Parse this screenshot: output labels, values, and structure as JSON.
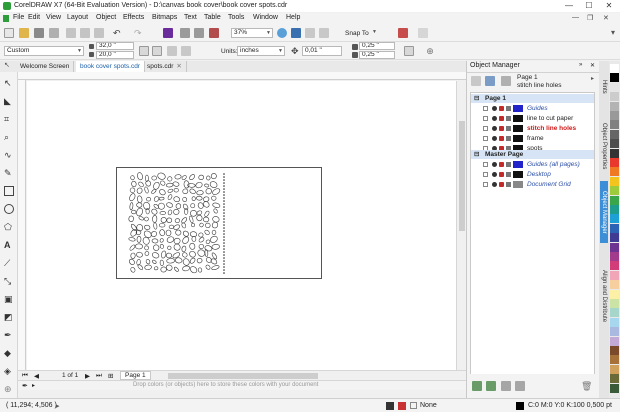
{
  "window": {
    "title": "CorelDRAW X7 (64-Bit Evaluation Version) - D:\\canvas book cover\\book cover spots.cdr"
  },
  "window_controls": {
    "minimize": "—",
    "maximize": "☐",
    "close": "✕"
  },
  "menu": [
    "File",
    "Edit",
    "View",
    "Layout",
    "Object",
    "Effects",
    "Bitmaps",
    "Text",
    "Table",
    "Tools",
    "Window",
    "Help"
  ],
  "standard_toolbar": {
    "zoom_value": "37%",
    "snap_to_label": "Snap To"
  },
  "property_bar": {
    "preset": "Custom",
    "width": "32,0 \"",
    "height": "20,0 \"",
    "units_label": "Units:",
    "units_value": "inches",
    "nudge": "0,01 \"",
    "dup_x": "0,25 \"",
    "dup_y": "0,25 \""
  },
  "tabs": [
    {
      "label": "Welcome Screen",
      "active": false
    },
    {
      "label": "book cover spots.cdr",
      "active": true
    },
    {
      "label": "spots.cdr",
      "active": false
    }
  ],
  "page_nav": {
    "counter": "1 of 1",
    "page_tab": "Page 1"
  },
  "hint": "Drop colors (or objects) here to store these colors with your document",
  "object_manager": {
    "title": "Object Manager",
    "current_page": "Page 1",
    "current_layer": "stitch line holes",
    "page1_label": "Page 1",
    "layers": [
      {
        "name": "Guides",
        "color": "#2323cc",
        "style": "italic"
      },
      {
        "name": "line to cut paper",
        "color": "#111111",
        "style": "normal"
      },
      {
        "name": "stitch line holes",
        "color": "#111111",
        "style": "active"
      },
      {
        "name": "frame",
        "color": "#111111",
        "style": "normal"
      },
      {
        "name": "spots",
        "color": "#111111",
        "style": "normal"
      }
    ],
    "master_label": "Master Page",
    "master_layers": [
      {
        "name": "Guides (all pages)",
        "color": "#2323cc"
      },
      {
        "name": "Desktop",
        "color": "#111111"
      },
      {
        "name": "Document Grid",
        "color": "#888888"
      }
    ]
  },
  "side_tabs": [
    "Hints",
    "Object Properties",
    "Object Manager",
    "Align and Distribute"
  ],
  "status": {
    "coords": "( 11,294; 4,506 )",
    "fill": "None",
    "outline": "C:0 M:0 Y:0 K:100  0,500 pt"
  },
  "colors": {
    "accent": "#3c8fd6",
    "active_layer": "#d01818",
    "group_header": "#d6e4f5"
  }
}
